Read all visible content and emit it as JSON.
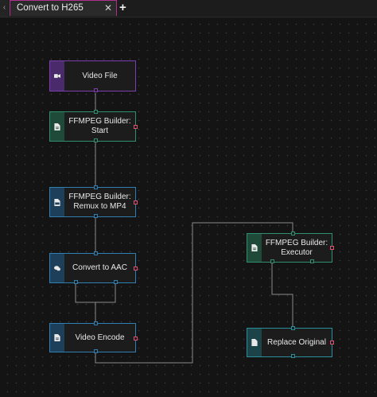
{
  "tabs": [
    {
      "label": "Convert to H265",
      "close_glyph": "✕",
      "active": true
    }
  ],
  "tab_scroll_glyph": "‹",
  "add_tab_glyph": "+",
  "colors": {
    "input_node": "#7b3fb0",
    "builder_node": "#2f8f6f",
    "ffmpeg_node": "#2f7fb2",
    "output_node": "#2a8f9a",
    "error_port": "#e0506e",
    "wire": "#8a8a8a",
    "tab_accent": "#b0308f"
  },
  "nodes": {
    "video_file": {
      "label": "Video File",
      "icon": "video-camera-icon"
    },
    "ffmpeg_start": {
      "label": "FFMPEG Builder:\nStart",
      "icon": "document-icon"
    },
    "remux_mp4": {
      "label": "FFMPEG Builder:\nRemux to MP4",
      "icon": "mp4-file-icon"
    },
    "convert_aac": {
      "label": "Convert to AAC",
      "icon": "chat-icon"
    },
    "video_encode": {
      "label": "Video Encode",
      "icon": "document-icon"
    },
    "executor": {
      "label": "FFMPEG Builder:\nExecutor",
      "icon": "document-icon"
    },
    "replace_original": {
      "label": "Replace Original",
      "icon": "file-icon"
    }
  }
}
